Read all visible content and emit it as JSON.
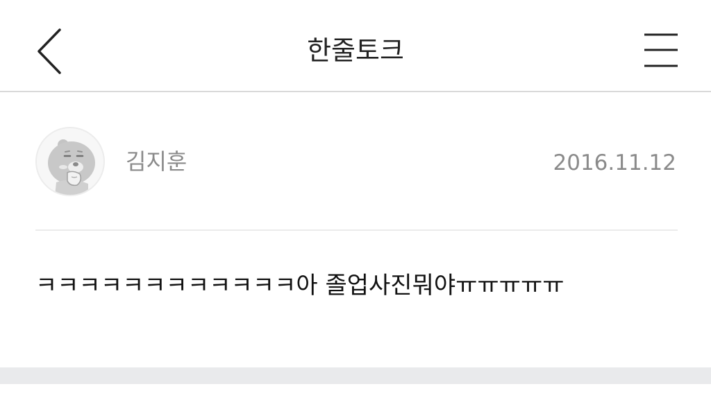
{
  "header": {
    "title": "한줄토크",
    "back_icon": "chevron-left-icon",
    "menu_icon": "hamburger-menu-icon"
  },
  "post": {
    "author": "김지훈",
    "date": "2016.11.12",
    "avatar_icon": "character-avatar-icon",
    "message": "ㅋㅋㅋㅋㅋㅋㅋㅋㅋㅋㅋㅋ아 졸업사진뭐야ㅠㅠㅠㅠㅠ"
  },
  "colors": {
    "text_primary": "#222222",
    "text_secondary": "#8a8a8a",
    "divider": "#d9d9d9",
    "footer_bar": "#e9eaec"
  }
}
